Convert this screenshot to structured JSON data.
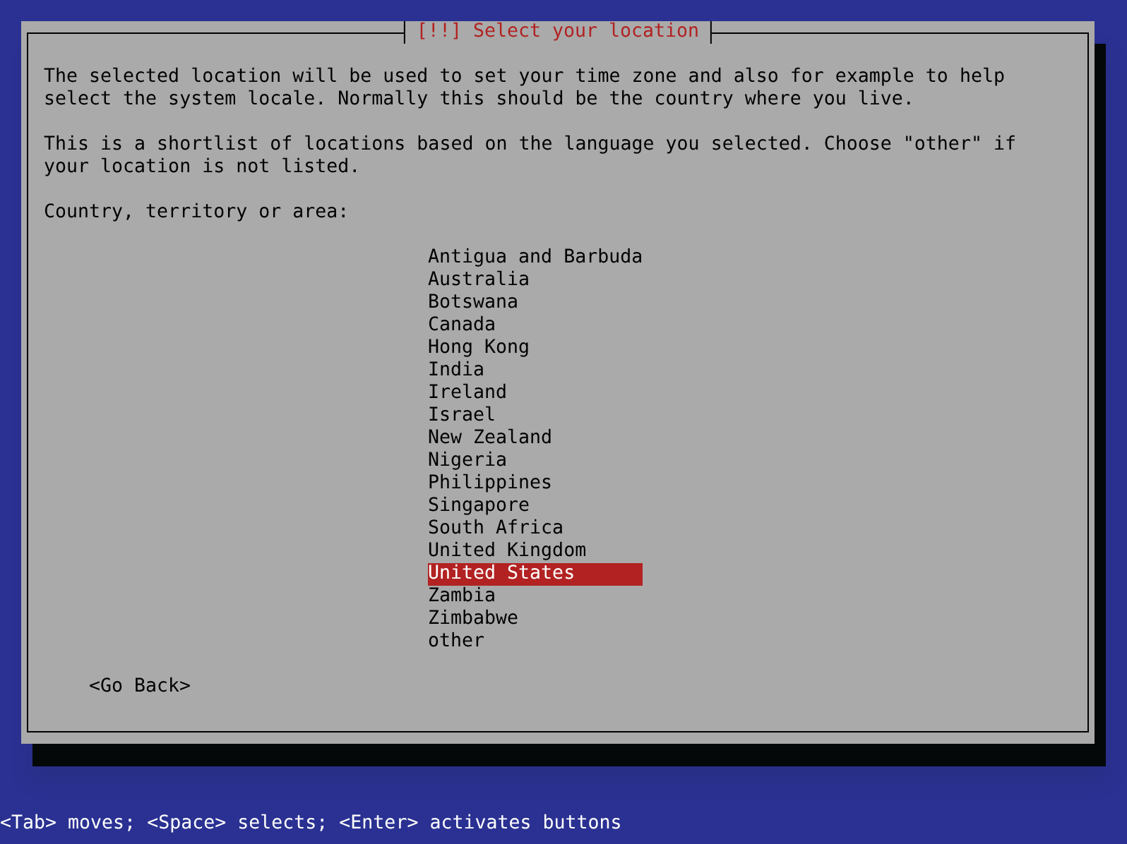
{
  "dialog": {
    "title": "[!!] Select your location",
    "paragraphs": [
      "The selected location will be used to set your time zone and also for example to help select the system locale. Normally this should be the country where you live.",
      "This is a shortlist of locations based on the language you selected. Choose \"other\" if your location is not listed."
    ],
    "list_label": "Country, territory or area:",
    "items": [
      {
        "label": "Antigua and Barbuda",
        "selected": false
      },
      {
        "label": "Australia",
        "selected": false
      },
      {
        "label": "Botswana",
        "selected": false
      },
      {
        "label": "Canada",
        "selected": false
      },
      {
        "label": "Hong Kong",
        "selected": false
      },
      {
        "label": "India",
        "selected": false
      },
      {
        "label": "Ireland",
        "selected": false
      },
      {
        "label": "Israel",
        "selected": false
      },
      {
        "label": "New Zealand",
        "selected": false
      },
      {
        "label": "Nigeria",
        "selected": false
      },
      {
        "label": "Philippines",
        "selected": false
      },
      {
        "label": "Singapore",
        "selected": false
      },
      {
        "label": "South Africa",
        "selected": false
      },
      {
        "label": "United Kingdom",
        "selected": false
      },
      {
        "label": "United States",
        "selected": true
      },
      {
        "label": "Zambia",
        "selected": false
      },
      {
        "label": "Zimbabwe",
        "selected": false
      },
      {
        "label": "other",
        "selected": false
      }
    ],
    "buttons": [
      "<Go Back>"
    ]
  },
  "status_bar": "<Tab> moves; <Space> selects; <Enter> activates buttons"
}
